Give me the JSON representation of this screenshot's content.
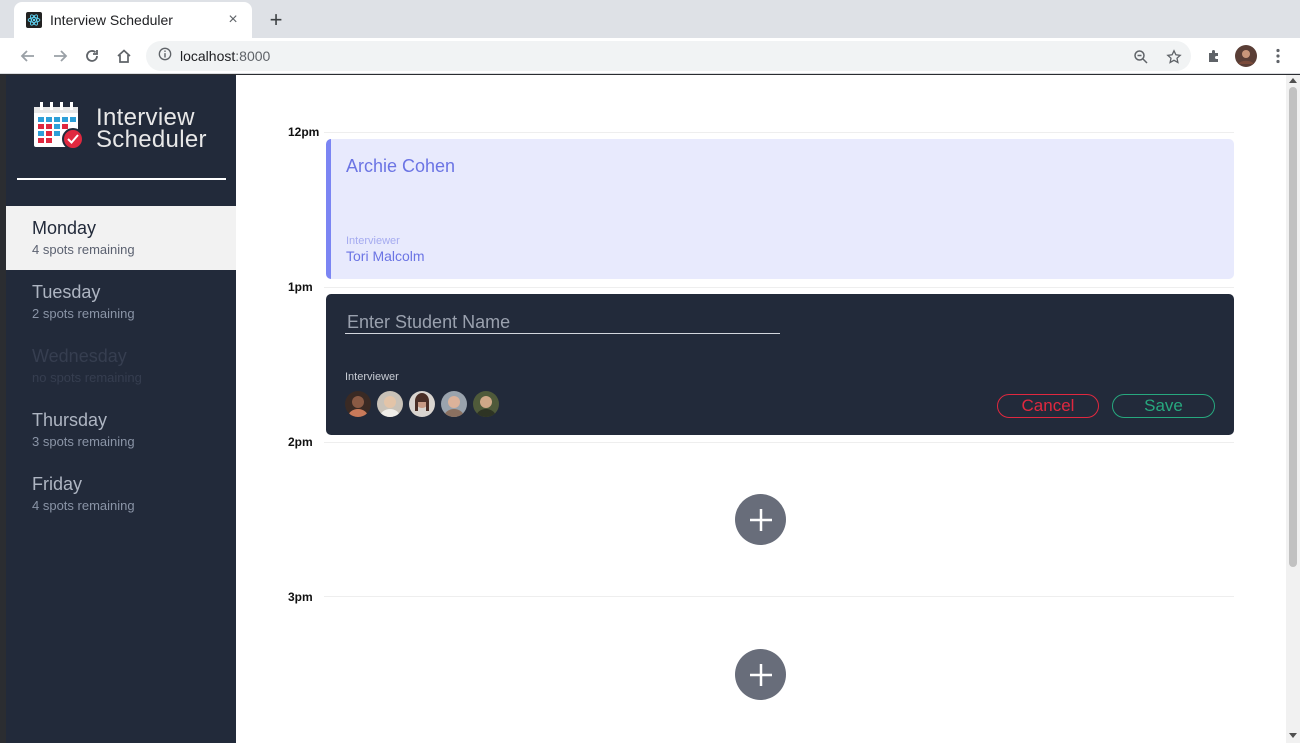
{
  "browser": {
    "tab_title": "Interview Scheduler",
    "tab_close": "×",
    "new_tab": "+",
    "url_host": "localhost",
    "url_port": ":8000"
  },
  "app": {
    "brand_line1": "Interview",
    "brand_line2": "Scheduler"
  },
  "days": [
    {
      "name": "Monday",
      "spots": "4 spots remaining",
      "state": "selected"
    },
    {
      "name": "Tuesday",
      "spots": "2 spots remaining",
      "state": "normal"
    },
    {
      "name": "Wednesday",
      "spots": "no spots remaining",
      "state": "full"
    },
    {
      "name": "Thursday",
      "spots": "3 spots remaining",
      "state": "normal"
    },
    {
      "name": "Friday",
      "spots": "4 spots remaining",
      "state": "normal"
    }
  ],
  "schedule": {
    "times": [
      "12pm",
      "1pm",
      "2pm",
      "3pm"
    ],
    "booked": {
      "student": "Archie Cohen",
      "interviewer_caption": "Interviewer",
      "interviewer": "Tori Malcolm"
    },
    "form": {
      "placeholder": "Enter Student Name",
      "interviewer_caption": "Interviewer",
      "cancel": "Cancel",
      "save": "Save",
      "avatar_colors": [
        "#6b4a3a",
        "#c9c2b8",
        "#8d5a4a",
        "#b9a090",
        "#4f5a3a"
      ]
    }
  },
  "colors": {
    "sidebar": "#222a3a",
    "booked_bg": "#e8eafd",
    "booked_accent": "#7b85f3",
    "cancel": "#e0283f",
    "save": "#27a87e",
    "add_button": "#686d7a"
  }
}
